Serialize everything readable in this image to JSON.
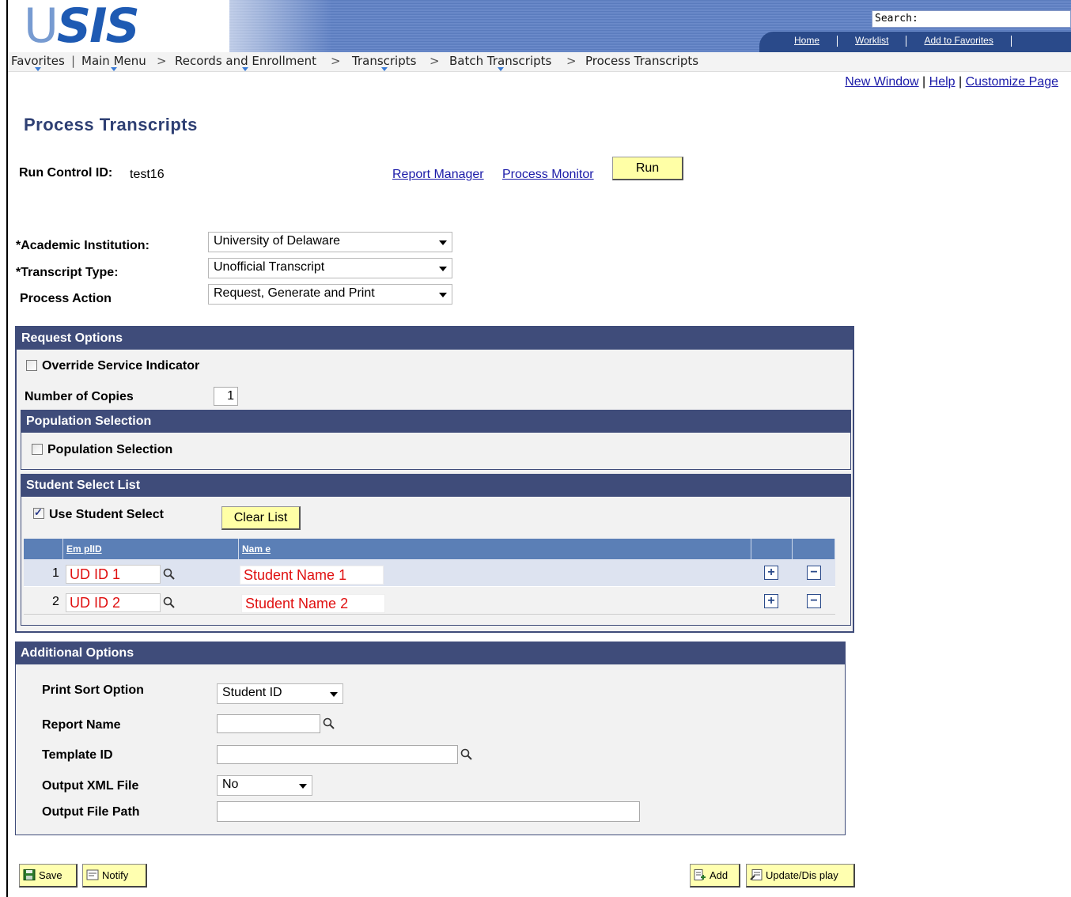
{
  "header": {
    "logo_text": "SIS",
    "logo_prefix": "U",
    "search_label": "Search:",
    "links": [
      "Home",
      "Worklist",
      "Add to Favorites"
    ]
  },
  "breadcrumb": {
    "items": [
      "Favorites",
      "Main Menu",
      "Records and Enrollment",
      "Transcripts",
      "Batch Transcripts",
      "Process Transcripts"
    ],
    "separator": ">"
  },
  "page_links": [
    "New Window",
    "Help",
    "Customize Page"
  ],
  "page": {
    "title": "Process Transcripts",
    "run_control_label": "Run Control ID:",
    "run_control_value": "test16",
    "report_manager": "Report Manager",
    "process_monitor": "Process Monitor",
    "run_button": "Run"
  },
  "fields": {
    "academic_institution_label": "*Academic Institution:",
    "academic_institution_value": "University of Delaware",
    "transcript_type_label": "*Transcript Type:",
    "transcript_type_value": "Unofficial Transcript",
    "process_action_label": "Process Action",
    "process_action_value": "Request, Generate and Print"
  },
  "request_options": {
    "header": "Request Options",
    "override_label": "Override Service Indicator",
    "override_checked": false,
    "copies_label": "Number of Copies",
    "copies_value": "1"
  },
  "population": {
    "header": "Population Selection",
    "checkbox_label": "Population Selection",
    "checked": false
  },
  "student_select": {
    "header": "Student Select List",
    "use_label": "Use Student Select",
    "use_checked": true,
    "clear_button": "Clear List",
    "columns": [
      "Em plID",
      "Nam e"
    ],
    "rows": [
      {
        "num": "1",
        "id": "UD ID 1",
        "name": "Student Name 1"
      },
      {
        "num": "2",
        "id": "UD ID 2",
        "name": "Student Name 2"
      }
    ]
  },
  "additional": {
    "header": "Additional Options",
    "print_sort_label": "Print Sort Option",
    "print_sort_value": "Student ID",
    "report_name_label": "Report Name",
    "template_id_label": "Template ID",
    "output_xml_label": "Output XML File",
    "output_xml_value": "No",
    "output_path_label": "Output File Path"
  },
  "toolbar": {
    "save": "Save",
    "notify": "Notify",
    "add": "Add",
    "update": "Update/Dis play"
  },
  "colors": {
    "panel_header": "#3f4c7a",
    "grid_header": "#5b7fb6",
    "button_yellow": "#ffffa6",
    "link": "#1a1aa8",
    "red_value": "#e01010"
  }
}
